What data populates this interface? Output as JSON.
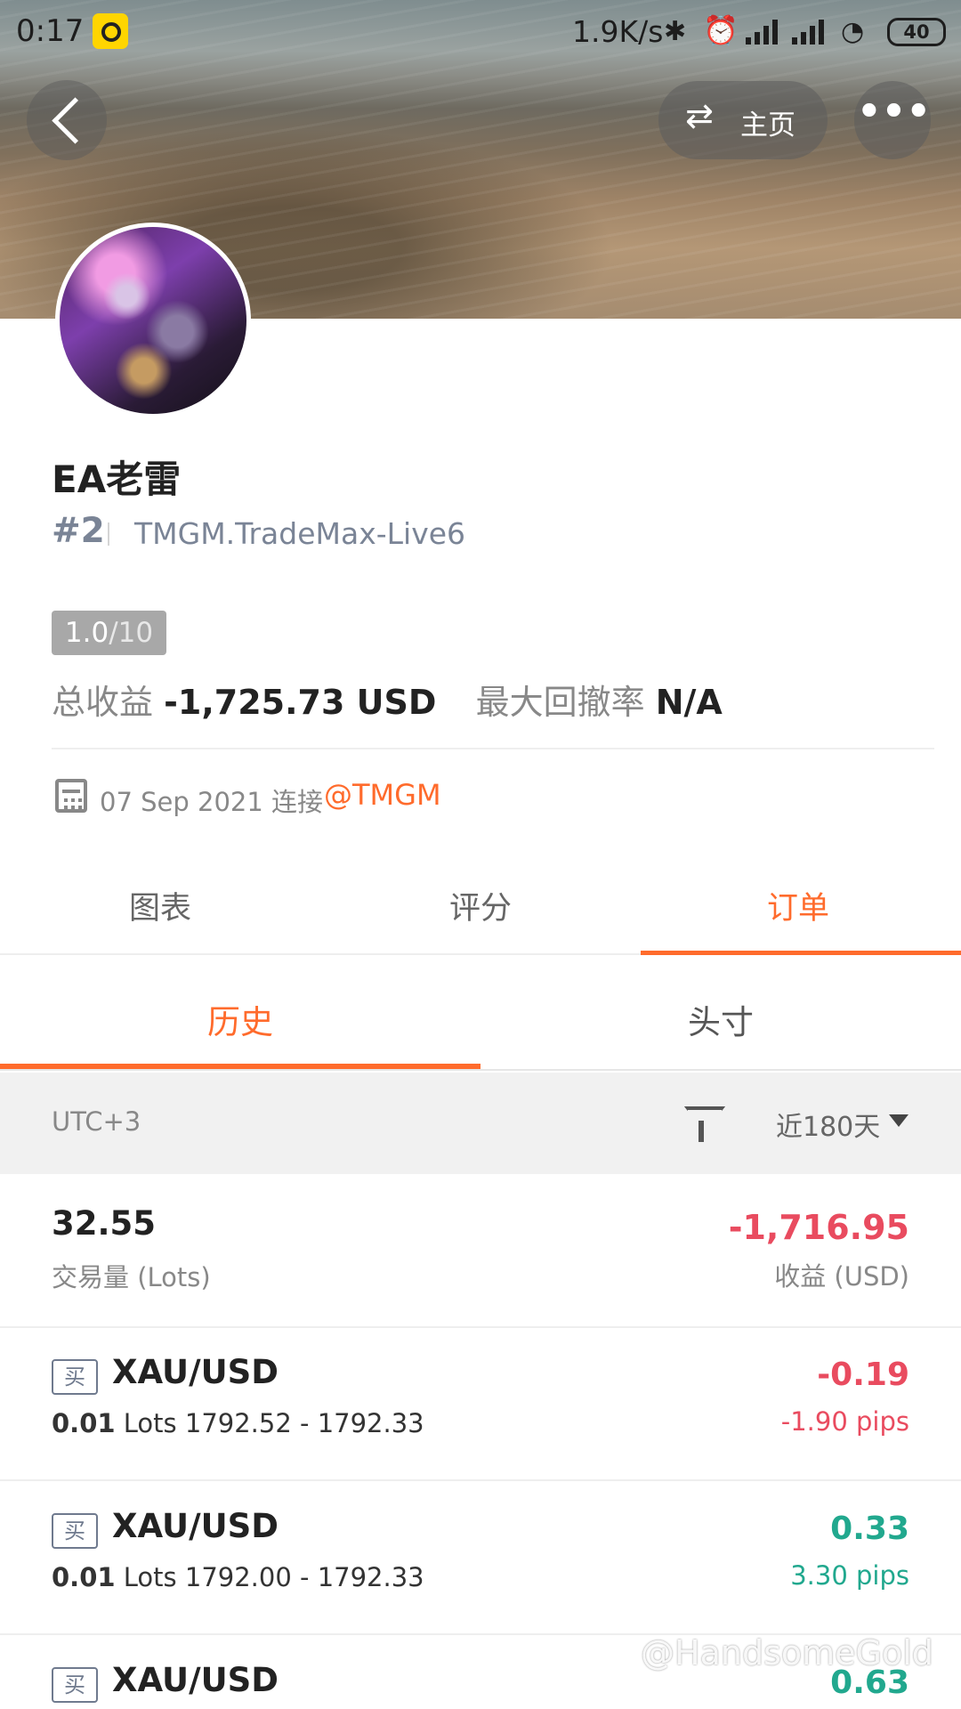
{
  "status_bar": {
    "time": "0:17",
    "network_speed": "1.9K/s",
    "battery": "40"
  },
  "header": {
    "home_label": "主页",
    "more_label": "•••"
  },
  "profile": {
    "name": "EA老雷",
    "rank": "#2",
    "server": "TMGM.TradeMax-Live6",
    "score": "1.0",
    "score_total": "/10",
    "total_profit_label": "总收益",
    "total_profit": "-1,725.73 USD",
    "max_drawdown_label": "最大回撤率",
    "max_drawdown": "N/A",
    "connected_date": "07 Sep 2021",
    "connected_label": "连接",
    "broker": "@TMGM"
  },
  "tabs": [
    {
      "label": "图表"
    },
    {
      "label": "评分"
    },
    {
      "label": "订单",
      "active": true
    }
  ],
  "subtabs": [
    {
      "label": "历史",
      "active": true
    },
    {
      "label": "头寸"
    }
  ],
  "filter": {
    "timezone": "UTC+3",
    "period": "近180天"
  },
  "summary": {
    "lots": "32.55",
    "lots_label": "交易量 (Lots)",
    "pnl": "-1,716.95",
    "pnl_label": "收益 (USD)"
  },
  "orders": [
    {
      "side": "买",
      "symbol": "XAU/USD",
      "lots": "0.01",
      "lots_unit": "Lots",
      "prices": "1792.52 - 1792.33",
      "pnl": "-0.19",
      "pips": "-1.90 pips"
    },
    {
      "side": "买",
      "symbol": "XAU/USD",
      "lots": "0.01",
      "lots_unit": "Lots",
      "prices": "1792.00 - 1792.33",
      "pnl": "0.33",
      "pips": "3.30 pips"
    },
    {
      "side": "买",
      "symbol": "XAU/USD",
      "lots": "",
      "lots_unit": "",
      "prices": "",
      "pnl": "0.63",
      "pips": ""
    }
  ],
  "watermark": "@HandsomeGold",
  "colors": {
    "accent": "#FF6B2C",
    "negative": "#E94B5F",
    "positive": "#21A88E"
  },
  "icons": {
    "back": "chevron-left",
    "home": "swap-arrows",
    "more": "three-dots",
    "calendar": "calendar",
    "filter": "funnel",
    "period": "triangle-down"
  }
}
